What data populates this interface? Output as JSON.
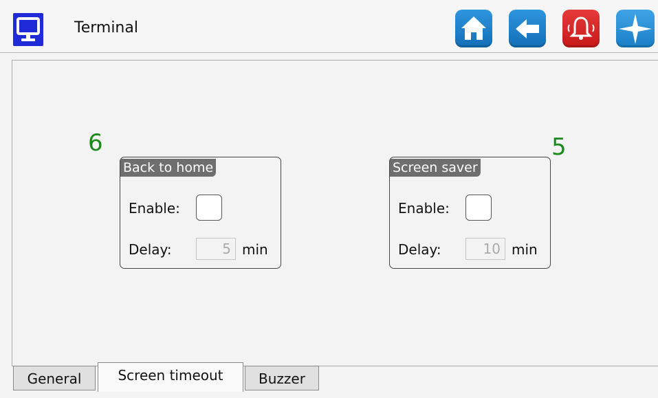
{
  "header": {
    "title": "Terminal",
    "buttons": [
      {
        "name": "home-button",
        "icon": "home-icon"
      },
      {
        "name": "back-button",
        "icon": "back-arrow-icon"
      },
      {
        "name": "alarm-button",
        "icon": "bell-alarm-icon"
      },
      {
        "name": "navigation-button",
        "icon": "compass-icon"
      }
    ]
  },
  "annotations": {
    "left_number": "6",
    "right_number": "5"
  },
  "back_to_home": {
    "title": "Back to home",
    "enable_label": "Enable:",
    "delay_label": "Delay:",
    "delay_value": "5",
    "unit": "min",
    "enabled": false
  },
  "screen_saver": {
    "title": "Screen saver",
    "enable_label": "Enable:",
    "delay_label": "Delay:",
    "delay_value": "10",
    "unit": "min",
    "enabled": false
  },
  "tabs": [
    {
      "label": "General",
      "active": false
    },
    {
      "label": "Screen timeout",
      "active": true
    },
    {
      "label": "Buzzer",
      "active": false
    }
  ],
  "colors": {
    "accent_blue": "#1f2bd6",
    "button_blue": "#1e82cc",
    "button_red": "#d42020",
    "annotation_green": "#1a8a1a"
  }
}
